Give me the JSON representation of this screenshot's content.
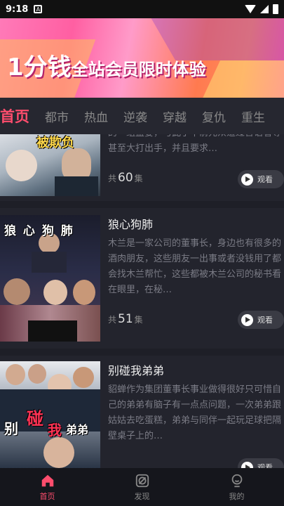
{
  "status_bar": {
    "time": "9:18",
    "notif_icon": "A"
  },
  "banner": {
    "title_big": "1分钱",
    "title_small": "全站会员限时体验"
  },
  "tabs": [
    {
      "label": "首页",
      "active": true
    },
    {
      "label": "都市"
    },
    {
      "label": "热血"
    },
    {
      "label": "逆袭"
    },
    {
      "label": "穿越"
    },
    {
      "label": "复仇"
    },
    {
      "label": "重生"
    }
  ],
  "cards": [
    {
      "thumb_text": "被欺负",
      "desc": "的一组盛宴，与此手中前元众遭过言语看辱甚至大打出手，并且要求…",
      "count_prefix": "共",
      "count": "60",
      "count_suffix": "集",
      "watch": "观看"
    },
    {
      "title": "狼心狗肺",
      "thumb_text": "狼 心 狗 肺",
      "desc": "木兰是一家公司的董事长，身边也有很多的酒肉朋友，这些朋友一出事或者没钱用了都会找木兰帮忙，这些都被木兰公司的秘书看在眼里，在秘…",
      "count_prefix": "共",
      "count": "51",
      "count_suffix": "集",
      "watch": "观看"
    },
    {
      "title": "别碰我弟弟",
      "thumb_text_1": "别",
      "thumb_text_2": "碰",
      "thumb_text_3": "我",
      "thumb_text_4": "弟弟",
      "desc": "貂蝉作为集团董事长事业做得很好只可惜自己的弟弟有脑子有一点点问题，一次弟弟跟姑姑去吃蛋糕，弟弟与同伴一起玩足球把隔壁桌子上的…",
      "watch": "观看"
    }
  ],
  "bottom_nav": [
    {
      "label": "首页",
      "icon": "home-icon",
      "active": true
    },
    {
      "label": "发现",
      "icon": "discover-icon"
    },
    {
      "label": "我的",
      "icon": "profile-icon"
    }
  ]
}
